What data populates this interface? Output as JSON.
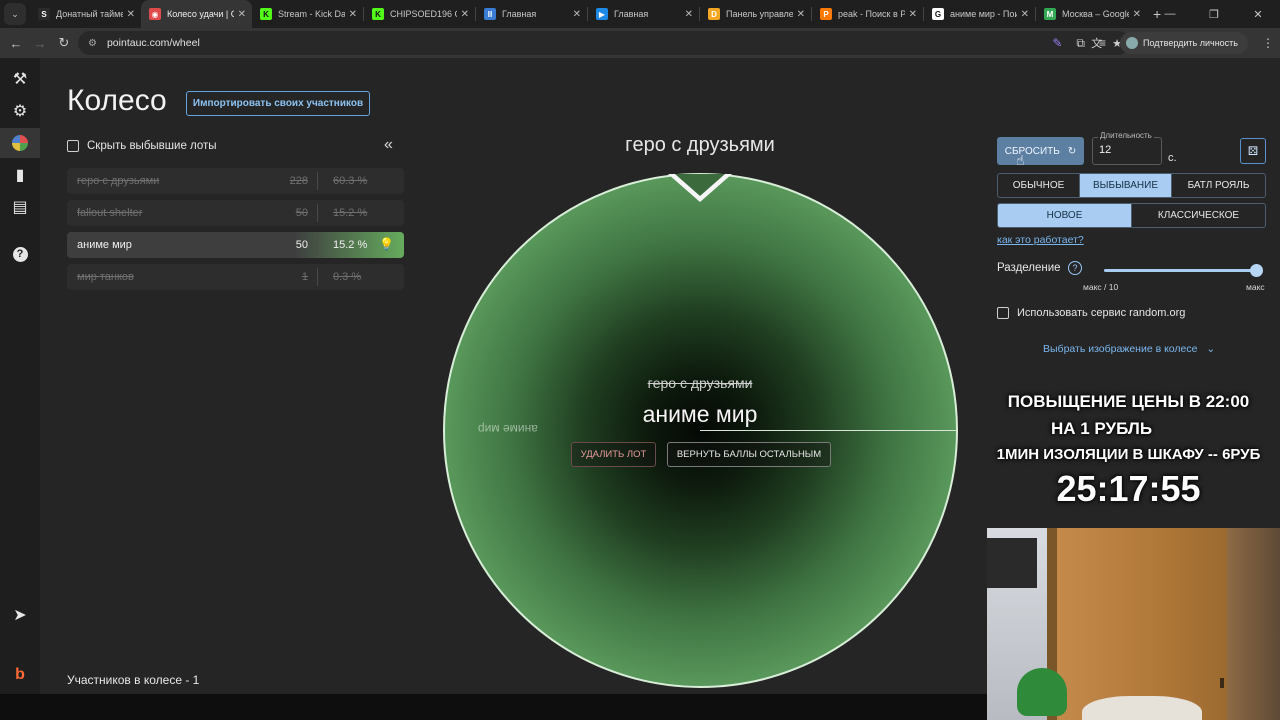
{
  "browser": {
    "tabs": [
      {
        "title": "Донатный таймер",
        "favicon": "S",
        "color": "#2b2b2b",
        "active": false
      },
      {
        "title": "Колесо удачи | С",
        "favicon": "◉",
        "color": "#e04b4b",
        "active": true
      },
      {
        "title": "Stream - Kick Das",
        "favicon": "K",
        "color": "#53fc18",
        "active": false
      },
      {
        "title": "CHIPSOED196 Cli",
        "favicon": "K",
        "color": "#53fc18",
        "active": false
      },
      {
        "title": "Главная",
        "favicon": "II",
        "color": "#3a7bd5",
        "active": false
      },
      {
        "title": "Главная",
        "favicon": "▶",
        "color": "#1e88e5",
        "active": false
      },
      {
        "title": "Панель управле",
        "favicon": "D",
        "color": "#f5a623",
        "active": false
      },
      {
        "title": "peak - Поиск в Pi",
        "favicon": "P",
        "color": "#ff7a00",
        "active": false
      },
      {
        "title": "аниме мир - Пои",
        "favicon": "G",
        "color": "#ffffff",
        "active": false
      },
      {
        "title": "Москва – Google",
        "favicon": "M",
        "color": "#34a853",
        "active": false
      }
    ],
    "url": "pointauc.com/wheel",
    "profile_label": "Подтвердить личность"
  },
  "page": {
    "title": "Колесо",
    "import_label": "Импортировать своих участников",
    "hide_label": "Скрыть выбывшие лоты",
    "collapse_icon": "«",
    "lots": [
      {
        "name": "гepo с друзьями",
        "amount": "228",
        "percent": "60.3 %",
        "state": "out"
      },
      {
        "name": "fallout shelter",
        "amount": "50",
        "percent": "15.2 %",
        "state": "out"
      },
      {
        "name": "аниме мир",
        "amount": "50",
        "percent": "15.2 %",
        "state": "selected"
      },
      {
        "name": "мир танков",
        "amount": "1",
        "percent": "0.3 %",
        "state": "out"
      }
    ],
    "participants_label": "Участников в колесе - 1"
  },
  "wheel": {
    "winner_top": "гepo с друзьями",
    "slice_label": "аниме мир",
    "center_eliminated": "гepo с друзьями",
    "center_current": "аниме мир",
    "delete_label": "УДАЛИТЬ ЛОТ",
    "return_label": "ВЕРНУТЬ БАЛЛЫ ОСТАЛЬНЫМ",
    "color": "#5fa061"
  },
  "panel": {
    "reset_label": "СБРОСИТЬ",
    "duration_label": "Длительность",
    "duration_value": "12",
    "duration_unit": "с.",
    "modes": [
      "ОБЫЧНОЕ",
      "ВЫБЫВАНИЕ",
      "БАТЛ РОЯЛЬ"
    ],
    "active_mode": 1,
    "variants": [
      "НОВОЕ",
      "КЛАССИЧЕСКОЕ"
    ],
    "active_variant": 0,
    "how_link": "как это работает?",
    "split_label": "Разделение",
    "split_min_label": "макс / 10",
    "split_max_label": "макс",
    "split_value": 1.0,
    "random_org_label": "Использовать сервис random.org",
    "image_select_label": "Выбрать изображение в колесе"
  },
  "overlay": {
    "line1": "ПОВЫЩЕНИЕ ЦЕНЫ В 22:00",
    "line2": "НА 1 РУБЛЬ",
    "line3": "1МИН ИЗОЛЯЦИИ В ШКАФУ -- 6РУБ",
    "timer": "25:17:55"
  },
  "colors": {
    "accent": "#a9cdf2",
    "link": "#7ab6ee",
    "selected_glow": "#6ebe64",
    "delete": "#e79a9a"
  }
}
